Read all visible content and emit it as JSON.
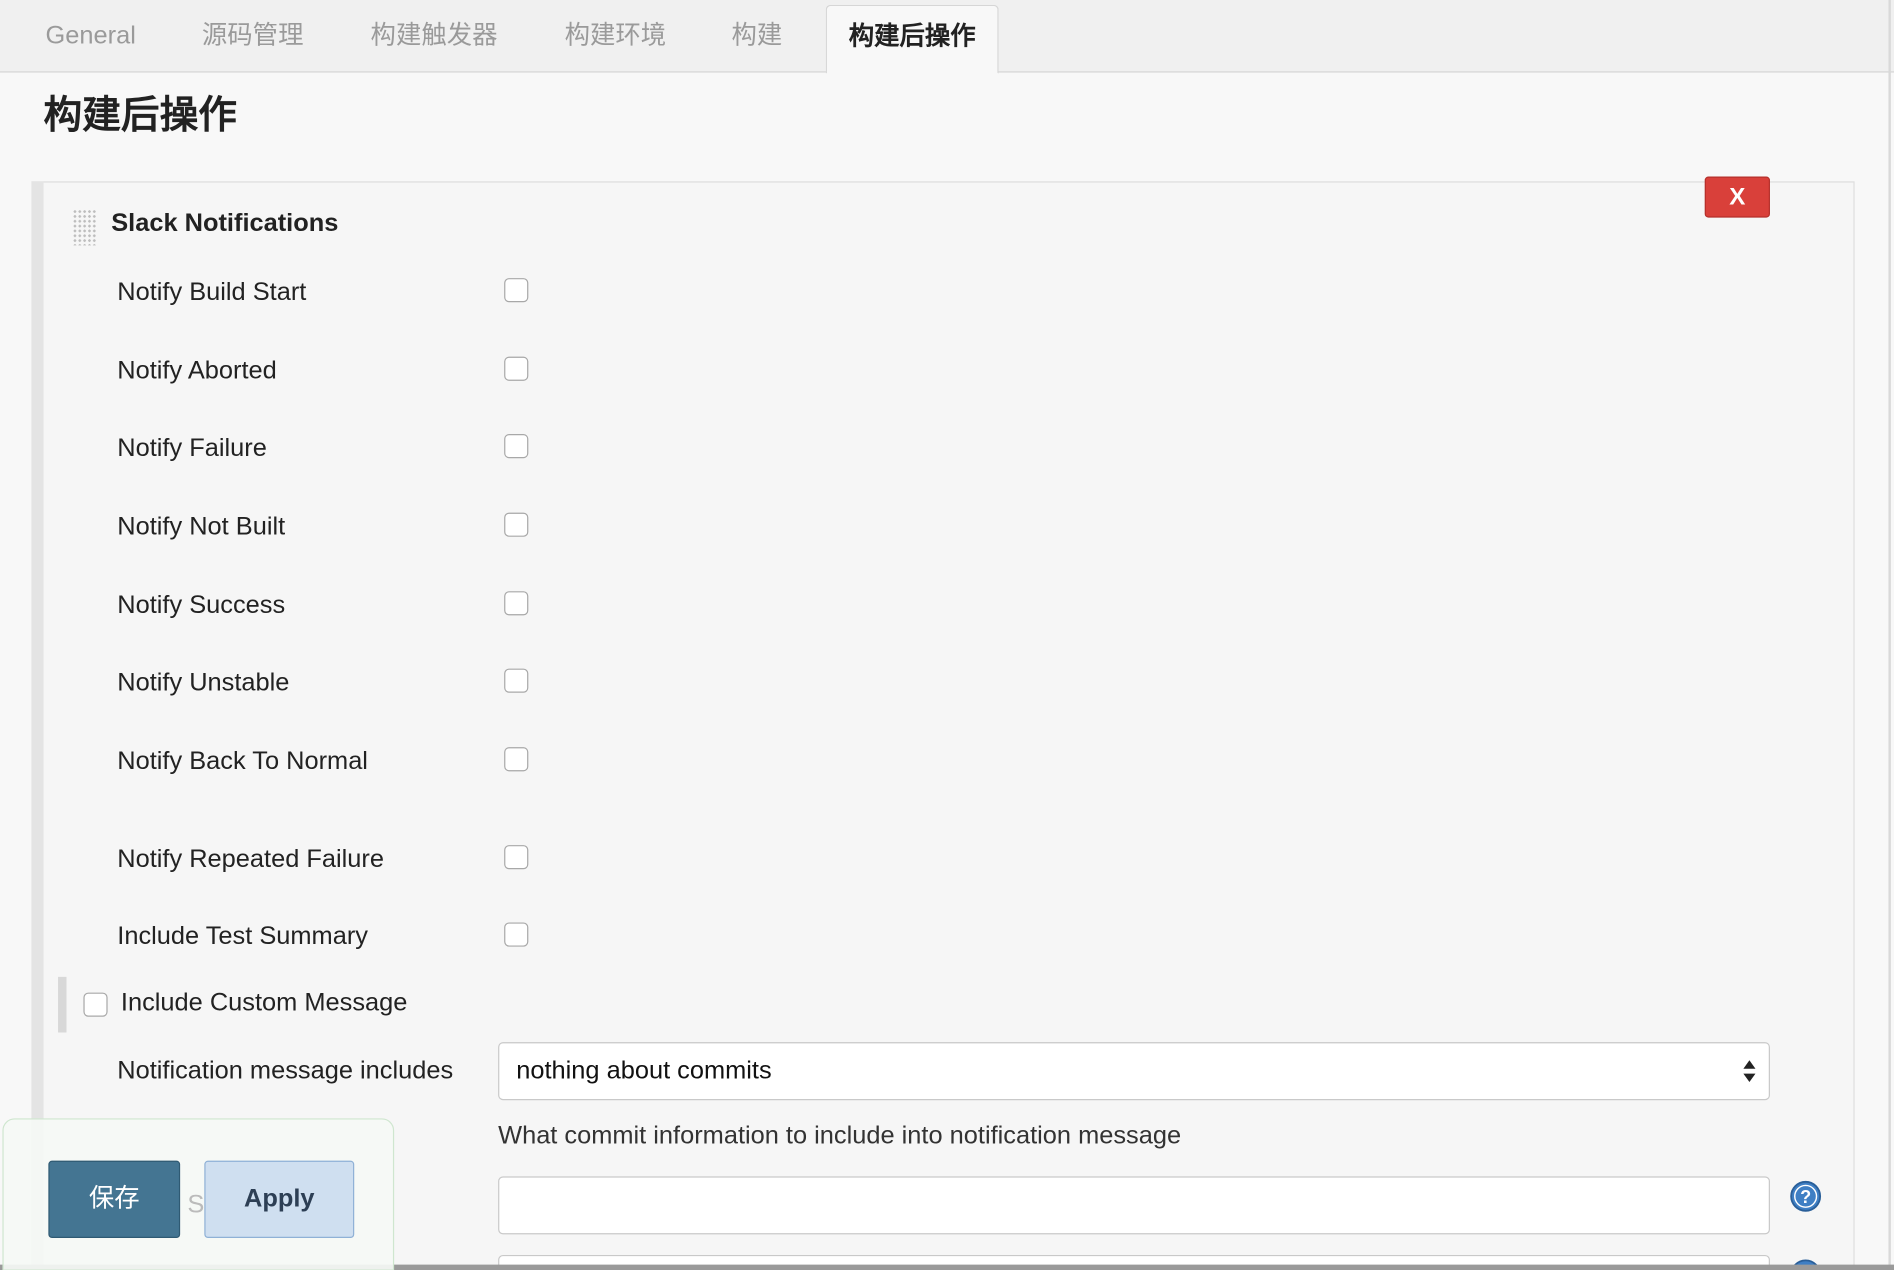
{
  "tabs": [
    {
      "label": "General",
      "active": false
    },
    {
      "label": "源码管理",
      "active": false
    },
    {
      "label": "构建触发器",
      "active": false
    },
    {
      "label": "构建环境",
      "active": false
    },
    {
      "label": "构建",
      "active": false
    },
    {
      "label": "构建后操作",
      "active": true
    }
  ],
  "section": {
    "title": "构建后操作"
  },
  "plugin": {
    "title": "Slack Notifications",
    "close_label": "X",
    "options": [
      {
        "label": "Notify Build Start",
        "checked": false
      },
      {
        "label": "Notify Aborted",
        "checked": false
      },
      {
        "label": "Notify Failure",
        "checked": false
      },
      {
        "label": "Notify Not Built",
        "checked": false
      },
      {
        "label": "Notify Success",
        "checked": false
      },
      {
        "label": "Notify Unstable",
        "checked": false
      },
      {
        "label": "Notify Back To Normal",
        "checked": false
      },
      {
        "label": "Notify Repeated Failure",
        "checked": false
      },
      {
        "label": "Include Test Summary",
        "checked": false
      }
    ],
    "custom_message": {
      "label": "Include Custom Message",
      "checked": false
    },
    "message_includes": {
      "label": "Notification message includes",
      "selected": "nothing about commits",
      "help": "What commit information to include into notification message"
    },
    "extra_input": {
      "value": ""
    }
  },
  "actions": {
    "save_label": "保存",
    "ghost_letter": "S",
    "apply_label": "Apply"
  },
  "colors": {
    "close_button": "#d9403a",
    "save_button": "#447592",
    "apply_button": "#cfdff0",
    "help_icon": "#3f7fc4"
  }
}
